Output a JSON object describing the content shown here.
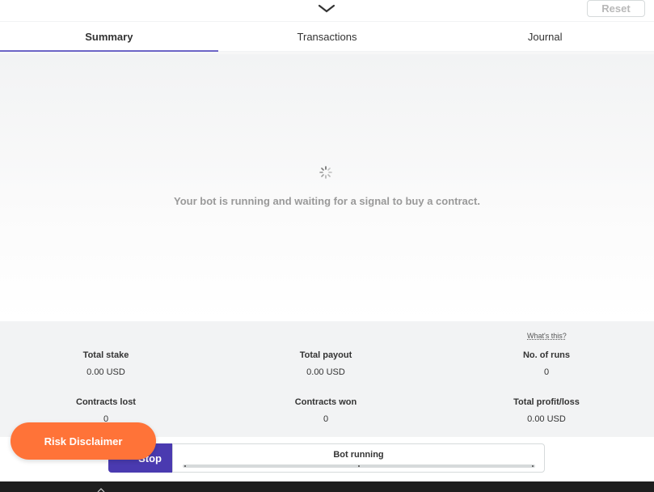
{
  "header": {
    "collapse_icon": "chevron-down-icon",
    "reset_label": "Reset"
  },
  "tabs": [
    {
      "label": "Summary",
      "active": true
    },
    {
      "label": "Transactions",
      "active": false
    },
    {
      "label": "Journal",
      "active": false
    }
  ],
  "main": {
    "spinner_icon": "loading-spinner-icon",
    "message": "Your bot is running and waiting for a signal to buy a contract."
  },
  "stats": {
    "whats_this": "What's this?",
    "items": [
      {
        "label": "Total stake",
        "value": "0.00 USD"
      },
      {
        "label": "Total payout",
        "value": "0.00 USD"
      },
      {
        "label": "No. of runs",
        "value": "0"
      },
      {
        "label": "Contracts lost",
        "value": "0"
      },
      {
        "label": "Contracts won",
        "value": "0"
      },
      {
        "label": "Total profit/loss",
        "value": "0.00 USD"
      }
    ]
  },
  "controls": {
    "stop_label": "Stop",
    "status_label": "Bot running",
    "risk_label": "Risk Disclaimer"
  },
  "colors": {
    "accent": "#6d65c6",
    "stop_button": "#4a3ab0",
    "risk_button": "#ff7338",
    "panel_bg": "#f2f3f4"
  }
}
